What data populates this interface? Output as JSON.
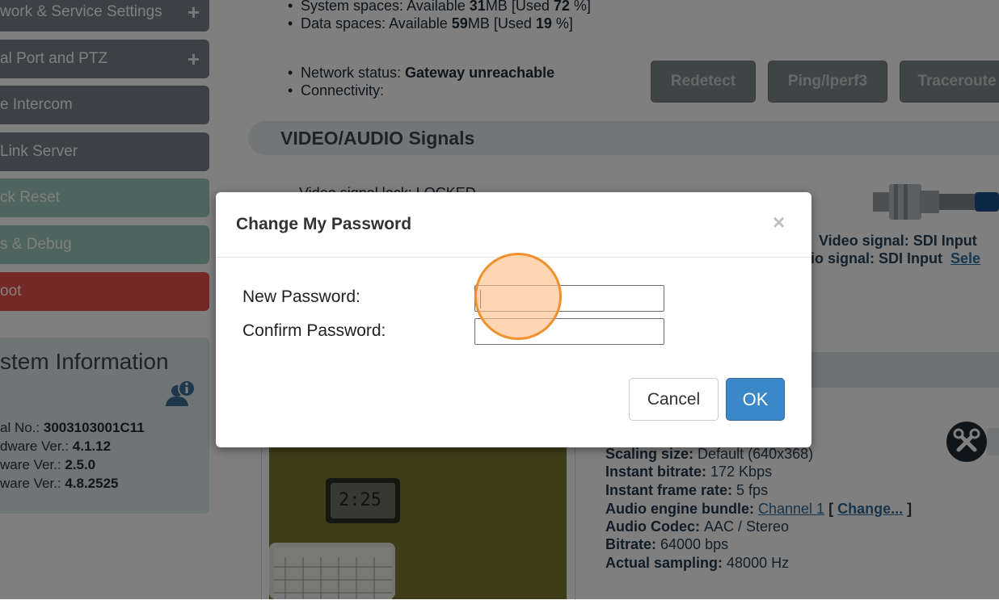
{
  "sidebar": {
    "items": [
      {
        "label": "work & Service Settings",
        "plus": "+"
      },
      {
        "label": "al Port and PTZ",
        "plus": "+"
      },
      {
        "label": "e Intercom"
      },
      {
        "label": "Link Server"
      },
      {
        "label": "ck Reset"
      },
      {
        "label": "s & Debug"
      },
      {
        "label": "oot"
      }
    ]
  },
  "system_info": {
    "title": "stem Information",
    "rows": [
      {
        "label": "al No.: ",
        "value": "3003103001C11"
      },
      {
        "label": "dware Ver.: ",
        "value": "4.1.12"
      },
      {
        "label": "ware Ver.: ",
        "value": "2.5.0"
      },
      {
        "label": "ware Ver.: ",
        "value": "4.8.2525"
      }
    ]
  },
  "storage": {
    "system_prefix": "System spaces: Available ",
    "system_avail": "31",
    "system_mid": "MB [Used ",
    "system_used": "72",
    "system_suffix": " %]",
    "data_prefix": "Data spaces: Available ",
    "data_avail": "59",
    "data_mid": "MB [Used ",
    "data_used": "19",
    "data_suffix": " %]"
  },
  "network": {
    "status_label": "Network status: ",
    "status_value": "Gateway unreachable",
    "connectivity_label": "Connectivity:",
    "buttons": {
      "redetect": "Redetect",
      "ping": "Ping/Iperf3",
      "traceroute": "Traceroute"
    }
  },
  "section": {
    "video_audio": "VIDEO/AUDIO Signals"
  },
  "signals": {
    "video_partial": "Video signal lock: LOCKED",
    "video": "Video signal: SDI Input",
    "audio": "io signal: SDI Input",
    "audio_link": "Sele"
  },
  "stats": {
    "scaling_label": "Scaling size: ",
    "scaling_value": "Default (640x368)",
    "bitrate_label": "Instant bitrate: ",
    "bitrate_value": "172 Kbps",
    "framerate_label": "Instant frame rate: ",
    "framerate_value": "5 fps",
    "bundle_label": "Audio engine bundle: ",
    "bundle_value": "Channel 1",
    "bundle_change": "Change...",
    "codec_label": "Audio Codec: ",
    "codec_value": "AAC / Stereo",
    "abitrate_label": "Bitrate: ",
    "abitrate_value": "64000 bps",
    "sampling_label": "Actual sampling: ",
    "sampling_value": "48000 Hz"
  },
  "modal": {
    "title": "Change My Password",
    "close": "×",
    "new_password_label": "New Password:",
    "confirm_password_label": "Confirm Password:",
    "new_password_value": "",
    "confirm_password_value": "",
    "cancel_label": "Cancel",
    "ok_label": "OK"
  },
  "colors": {
    "ok_button": "#3b88c8",
    "click_indicator": "#f0912e",
    "sidebar_red": "#e8534c",
    "sidebar_green": "#9cc9bc"
  }
}
